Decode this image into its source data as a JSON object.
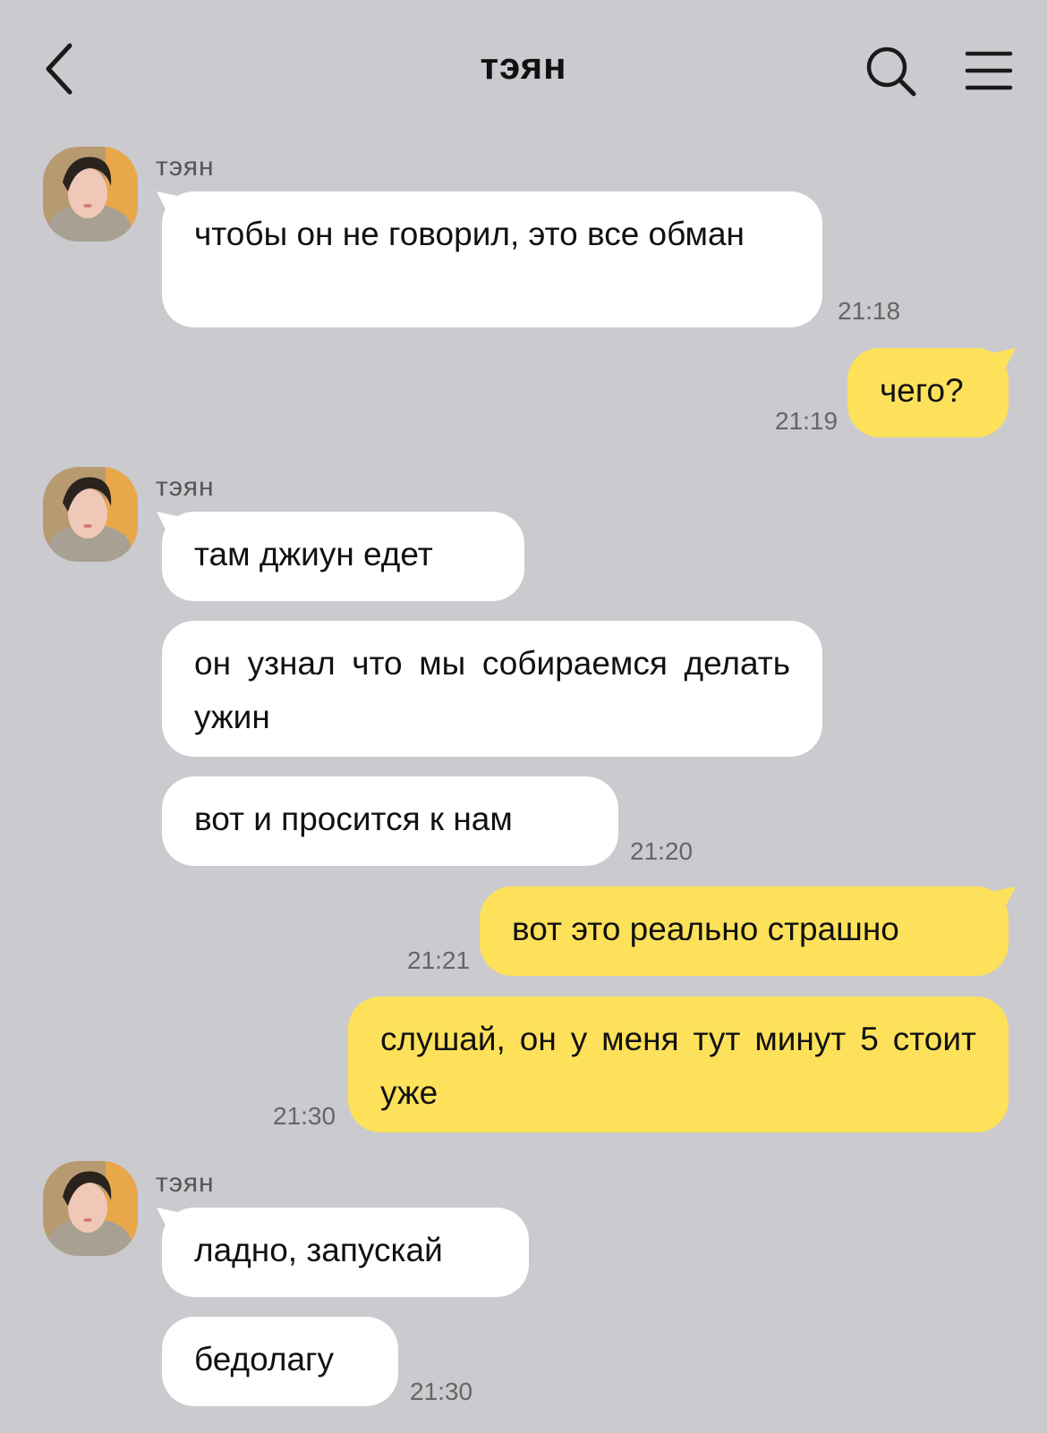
{
  "header": {
    "title": "тэян",
    "back_icon": "chevron-left-icon",
    "search_icon": "search-icon",
    "menu_icon": "menu-icon"
  },
  "colors": {
    "background": "#cacacf",
    "incoming_bubble": "#ffffff",
    "outgoing_bubble": "#fee15a"
  },
  "messages": [
    {
      "direction": "in",
      "sender": "тэян",
      "text": "чтобы он не говорил, это все обман",
      "time": "21:18"
    },
    {
      "direction": "out",
      "text": "чего?",
      "time": "21:19"
    },
    {
      "direction": "in",
      "sender": "тэян",
      "text": "там джиун едет"
    },
    {
      "direction": "in",
      "text": "он узнал что мы собираемся делать ужин"
    },
    {
      "direction": "in",
      "text": "вот и просится к нам",
      "time": "21:20"
    },
    {
      "direction": "out",
      "text": "вот это реально страшно",
      "time": "21:21"
    },
    {
      "direction": "out",
      "text": "слушай, он у меня тут минут 5 стоит уже",
      "time": "21:30"
    },
    {
      "direction": "in",
      "sender": "тэян",
      "text": "ладно, запускай"
    },
    {
      "direction": "in",
      "text": "бедолагу",
      "time": "21:30"
    }
  ]
}
